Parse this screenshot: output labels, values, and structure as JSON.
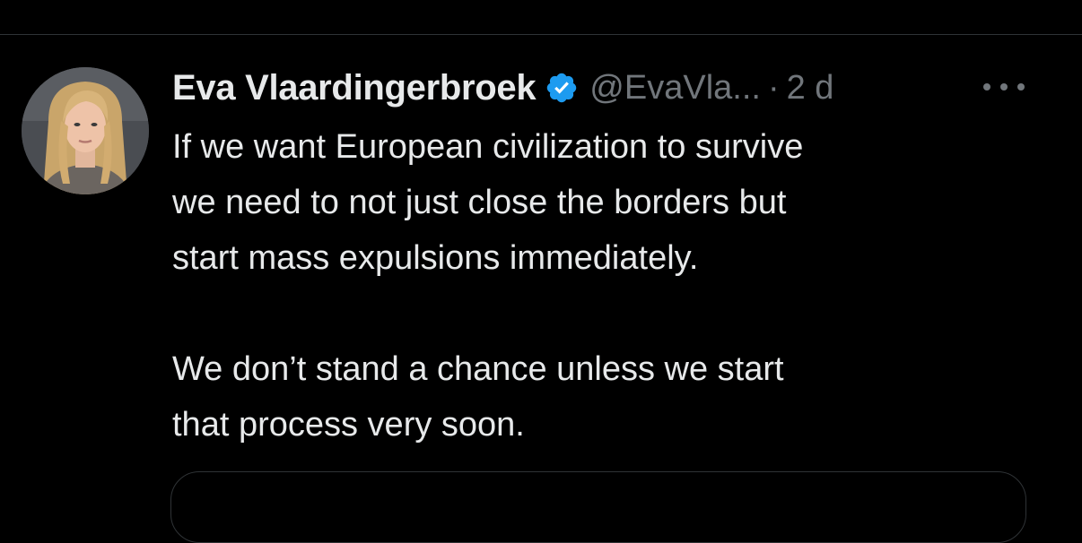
{
  "tweet": {
    "author": {
      "display_name": "Eva Vlaardingerbroek",
      "handle": "@EvaVla...",
      "verified_icon": "verified-badge-icon",
      "avatar": "profile-photo"
    },
    "separator": "·",
    "timestamp": "2 d",
    "more_icon": "more-options-icon",
    "text_paragraph_1": [
      "If we want European civilization to survive",
      "we need to not just close the borders but",
      "start mass expulsions immediately."
    ],
    "text_paragraph_2": [
      "We don’t stand a chance unless we start",
      "that process very soon."
    ]
  },
  "colors": {
    "background": "#000000",
    "primary_text": "#e7e9ea",
    "secondary_text": "#71767b",
    "verified_blue": "#1d9bf0",
    "border": "#2f3336"
  }
}
